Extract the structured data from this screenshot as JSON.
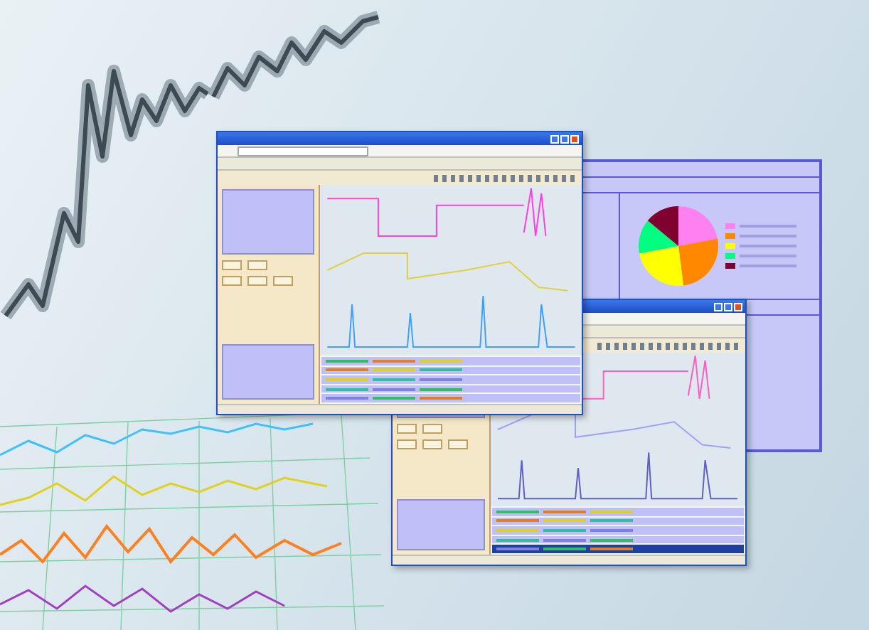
{
  "windows": [
    {
      "kind": "report",
      "slices": [
        {
          "color": "#ff80f0"
        },
        {
          "color": "#ff8800"
        },
        {
          "color": "#ffff00"
        },
        {
          "color": "#00ff80"
        },
        {
          "color": "#800030"
        }
      ]
    },
    {
      "kind": "monitor",
      "trace_colors": [
        {
          "color": "#ff40e0"
        },
        {
          "color": "#e0d040"
        },
        {
          "color": "#40a0ff"
        }
      ]
    },
    {
      "kind": "monitor",
      "trace_colors": [
        {
          "color": "#ff60c0"
        },
        {
          "color": "#a0a0ff"
        },
        {
          "color": "#6060c0"
        }
      ]
    }
  ]
}
